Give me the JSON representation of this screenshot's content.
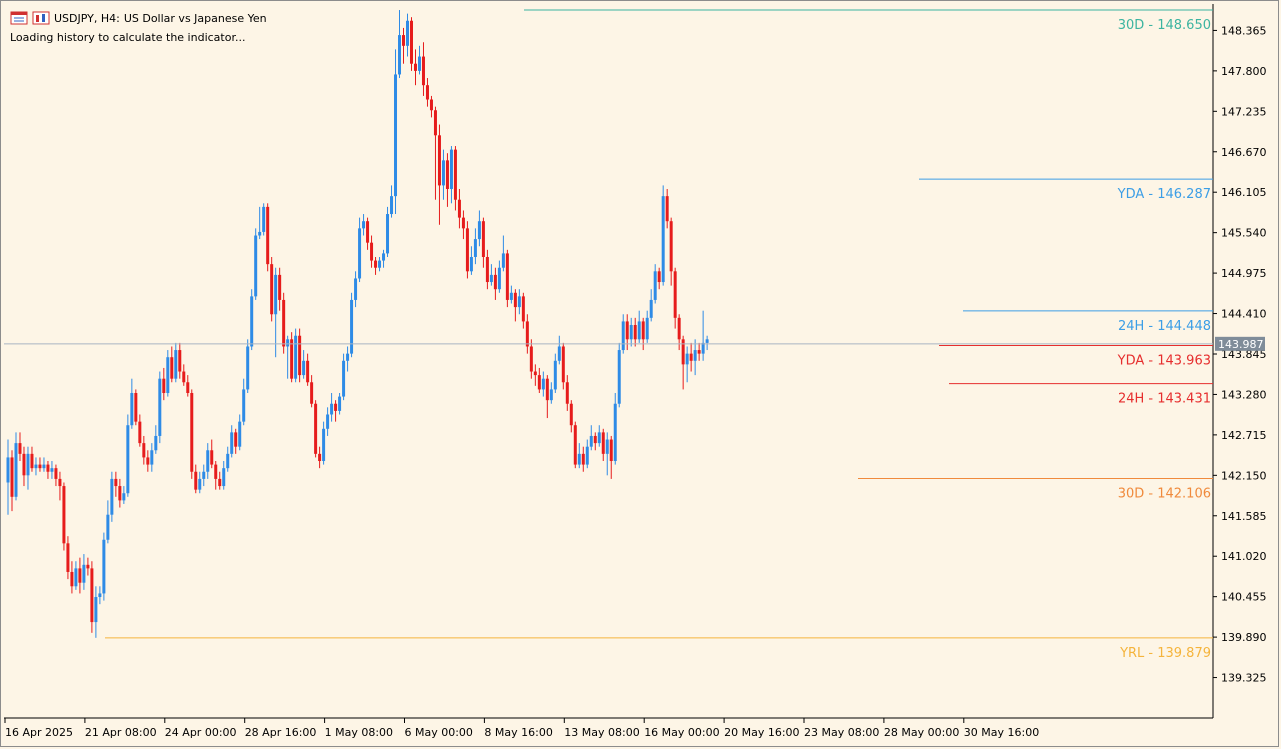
{
  "header": {
    "symbol": "USDJPY, H4:",
    "description": "US Dollar vs Japanese Yen",
    "status": "Loading history to calculate the indicator..."
  },
  "chart_data": {
    "type": "candlestick",
    "symbol": "USDJPY",
    "timeframe": "H4",
    "ylim": [
      138.76,
      148.79
    ],
    "y_ticks": [
      "148.365",
      "147.800",
      "147.235",
      "146.670",
      "146.105",
      "145.540",
      "144.975",
      "144.410",
      "143.845",
      "143.280",
      "142.715",
      "142.150",
      "141.585",
      "141.020",
      "140.455",
      "139.890",
      "139.325"
    ],
    "x_ticks": [
      "16 Apr 2025",
      "21 Apr 08:00",
      "24 Apr 00:00",
      "28 Apr 16:00",
      "1 May 08:00",
      "6 May 00:00",
      "8 May 16:00",
      "13 May 08:00",
      "16 May 00:00",
      "20 May 16:00",
      "23 May 08:00",
      "28 May 00:00",
      "30 May 16:00"
    ],
    "current_price": {
      "value": 143.987,
      "label": "143.987",
      "color": "#7f8c99"
    },
    "levels": [
      {
        "label": "30D - 148.650",
        "value": 148.65,
        "color": "#3cb4a0",
        "x_start": 524
      },
      {
        "label": "YDA - 146.287",
        "value": 146.287,
        "color": "#3c9ee6",
        "x_start": 919
      },
      {
        "label": "24H - 144.448",
        "value": 144.448,
        "color": "#3c9ee6",
        "x_start": 963
      },
      {
        "label": "YDA - 143.963",
        "value": 143.963,
        "color": "#e62e2e",
        "x_start": 939
      },
      {
        "label": "24H - 143.431",
        "value": 143.431,
        "color": "#e62e2e",
        "x_start": 949
      },
      {
        "label": "30D - 142.106",
        "value": 142.106,
        "color": "#f08a3c",
        "x_start": 858
      },
      {
        "label": "YRL - 139.879",
        "value": 139.879,
        "color": "#f5b43c",
        "x_start": 105
      }
    ],
    "candle_colors": {
      "up": "#2e8be6",
      "down": "#e61c1c"
    },
    "candle_x_start": 8,
    "candle_spacing": 3.995,
    "candles": [
      [
        142.05,
        142.4,
        142.65,
        141.6
      ],
      [
        142.4,
        141.85,
        142.5,
        141.65
      ],
      [
        141.85,
        142.6,
        142.75,
        141.8
      ],
      [
        142.6,
        142.45,
        142.75,
        142.35
      ],
      [
        142.45,
        142.15,
        142.55,
        142.0
      ],
      [
        142.15,
        142.45,
        142.55,
        141.95
      ],
      [
        142.45,
        142.25,
        142.55,
        142.2
      ],
      [
        142.25,
        142.3,
        142.4,
        142.15
      ],
      [
        142.3,
        142.25,
        142.4,
        142.2
      ],
      [
        142.25,
        142.3,
        142.4,
        142.2
      ],
      [
        142.3,
        142.2,
        142.35,
        142.1
      ],
      [
        142.2,
        142.25,
        142.35,
        142.1
      ],
      [
        142.25,
        142.1,
        142.3,
        142.0
      ],
      [
        142.1,
        142.0,
        142.2,
        141.8
      ],
      [
        142.0,
        141.2,
        142.05,
        141.1
      ],
      [
        141.2,
        140.8,
        141.3,
        140.7
      ],
      [
        140.8,
        140.6,
        140.95,
        140.5
      ],
      [
        140.6,
        140.85,
        140.95,
        140.55
      ],
      [
        140.85,
        140.65,
        141.0,
        140.5
      ],
      [
        140.65,
        140.9,
        141.05,
        140.55
      ],
      [
        140.9,
        140.85,
        141.0,
        140.75
      ],
      [
        140.85,
        140.1,
        140.95,
        139.95
      ],
      [
        140.1,
        140.45,
        140.6,
        139.88
      ],
      [
        140.45,
        140.5,
        140.6,
        140.35
      ],
      [
        140.5,
        141.25,
        141.35,
        140.4
      ],
      [
        141.25,
        141.6,
        141.8,
        141.2
      ],
      [
        141.6,
        142.1,
        142.2,
        141.5
      ],
      [
        142.1,
        142.0,
        142.2,
        141.85
      ],
      [
        142.0,
        141.8,
        142.1,
        141.7
      ],
      [
        141.8,
        141.9,
        142.0,
        141.75
      ],
      [
        141.9,
        142.85,
        143.0,
        141.85
      ],
      [
        142.85,
        143.3,
        143.5,
        142.8
      ],
      [
        143.3,
        142.9,
        143.35,
        142.85
      ],
      [
        142.9,
        142.6,
        143.0,
        142.55
      ],
      [
        142.6,
        142.4,
        142.7,
        142.3
      ],
      [
        142.4,
        142.3,
        142.5,
        142.2
      ],
      [
        142.3,
        142.5,
        142.6,
        142.2
      ],
      [
        142.5,
        142.7,
        142.85,
        142.45
      ],
      [
        142.7,
        143.5,
        143.6,
        142.6
      ],
      [
        143.5,
        143.3,
        143.65,
        143.2
      ],
      [
        143.3,
        143.8,
        143.9,
        143.25
      ],
      [
        143.8,
        143.5,
        143.95,
        143.45
      ],
      [
        143.5,
        143.9,
        144.0,
        143.45
      ],
      [
        143.9,
        143.6,
        144.0,
        143.5
      ],
      [
        143.6,
        143.45,
        143.7,
        143.4
      ],
      [
        143.45,
        143.3,
        143.55,
        143.25
      ],
      [
        143.3,
        142.2,
        143.35,
        142.1
      ],
      [
        142.2,
        141.95,
        142.3,
        141.9
      ],
      [
        141.95,
        142.1,
        142.2,
        141.9
      ],
      [
        142.1,
        142.2,
        142.3,
        142.0
      ],
      [
        142.2,
        142.5,
        142.6,
        142.1
      ],
      [
        142.5,
        142.3,
        142.65,
        142.25
      ],
      [
        142.3,
        142.1,
        142.35,
        141.95
      ],
      [
        142.1,
        142.0,
        142.2,
        141.95
      ],
      [
        142.0,
        142.25,
        142.35,
        141.95
      ],
      [
        142.25,
        142.45,
        142.55,
        142.2
      ],
      [
        142.45,
        142.75,
        142.85,
        142.4
      ],
      [
        142.75,
        142.55,
        142.8,
        142.45
      ],
      [
        142.55,
        142.9,
        143.0,
        142.5
      ],
      [
        142.9,
        143.35,
        143.5,
        142.85
      ],
      [
        143.35,
        143.95,
        144.05,
        143.3
      ],
      [
        143.95,
        144.65,
        144.75,
        143.9
      ],
      [
        144.65,
        145.5,
        145.6,
        144.6
      ],
      [
        145.5,
        145.55,
        145.9,
        145.45
      ],
      [
        145.55,
        145.9,
        145.95,
        145.5
      ],
      [
        145.9,
        145.1,
        145.95,
        145.0
      ],
      [
        145.1,
        144.4,
        145.2,
        144.3
      ],
      [
        144.4,
        144.95,
        145.05,
        143.8
      ],
      [
        144.95,
        144.6,
        145.05,
        144.45
      ],
      [
        144.6,
        143.95,
        144.7,
        143.85
      ],
      [
        143.95,
        144.05,
        144.1,
        143.5
      ],
      [
        144.05,
        143.5,
        144.15,
        143.45
      ],
      [
        143.5,
        144.1,
        144.2,
        143.45
      ],
      [
        144.1,
        143.55,
        144.2,
        143.45
      ],
      [
        143.55,
        143.75,
        143.9,
        143.5
      ],
      [
        143.75,
        143.45,
        143.85,
        143.4
      ],
      [
        143.45,
        143.15,
        143.55,
        143.1
      ],
      [
        143.15,
        142.45,
        143.2,
        142.4
      ],
      [
        142.45,
        142.35,
        142.55,
        142.25
      ],
      [
        142.35,
        142.8,
        142.9,
        142.3
      ],
      [
        142.8,
        143.0,
        143.1,
        142.7
      ],
      [
        143.0,
        143.15,
        143.3,
        142.9
      ],
      [
        143.15,
        143.05,
        143.2,
        142.9
      ],
      [
        143.05,
        143.25,
        143.3,
        143.0
      ],
      [
        143.25,
        143.75,
        143.85,
        143.2
      ],
      [
        143.75,
        143.85,
        143.95,
        143.6
      ],
      [
        143.85,
        144.6,
        144.7,
        143.8
      ],
      [
        144.6,
        144.9,
        145.0,
        144.5
      ],
      [
        144.9,
        145.6,
        145.75,
        144.85
      ],
      [
        145.6,
        145.7,
        145.8,
        145.5
      ],
      [
        145.7,
        145.4,
        145.75,
        145.3
      ],
      [
        145.4,
        145.15,
        145.5,
        145.05
      ],
      [
        145.15,
        145.05,
        145.2,
        144.95
      ],
      [
        145.05,
        145.15,
        145.2,
        145.0
      ],
      [
        145.15,
        145.25,
        145.3,
        145.05
      ],
      [
        145.25,
        145.8,
        145.9,
        145.2
      ],
      [
        145.8,
        146.05,
        146.2,
        145.75
      ],
      [
        146.05,
        147.75,
        148.1,
        145.8
      ],
      [
        147.75,
        148.3,
        148.65,
        147.7
      ],
      [
        148.3,
        148.15,
        148.4,
        147.9
      ],
      [
        148.15,
        148.5,
        148.6,
        148.0
      ],
      [
        148.5,
        147.9,
        148.55,
        147.8
      ],
      [
        147.9,
        147.8,
        148.1,
        147.6
      ],
      [
        147.8,
        148.0,
        148.15,
        147.75
      ],
      [
        148.0,
        147.6,
        148.2,
        147.45
      ],
      [
        147.6,
        147.4,
        147.7,
        147.3
      ],
      [
        147.4,
        147.25,
        147.45,
        147.15
      ],
      [
        147.25,
        146.9,
        147.3,
        146.0
      ],
      [
        146.9,
        146.2,
        147.05,
        145.65
      ],
      [
        146.2,
        146.55,
        146.7,
        146.0
      ],
      [
        146.55,
        146.15,
        146.65,
        145.9
      ],
      [
        146.15,
        146.7,
        146.75,
        145.95
      ],
      [
        146.7,
        146.0,
        146.75,
        145.85
      ],
      [
        146.0,
        145.75,
        146.15,
        145.6
      ],
      [
        145.75,
        145.6,
        145.85,
        145.45
      ],
      [
        145.6,
        145.0,
        145.7,
        144.9
      ],
      [
        145.0,
        145.2,
        145.35,
        144.95
      ],
      [
        145.2,
        145.45,
        145.6,
        145.1
      ],
      [
        145.45,
        145.7,
        145.85,
        145.35
      ],
      [
        145.7,
        145.2,
        145.75,
        145.05
      ],
      [
        145.2,
        144.85,
        145.3,
        144.75
      ],
      [
        144.85,
        144.95,
        145.1,
        144.8
      ],
      [
        144.95,
        144.75,
        145.05,
        144.6
      ],
      [
        144.75,
        145.05,
        145.15,
        144.7
      ],
      [
        145.05,
        145.25,
        145.5,
        145.0
      ],
      [
        145.25,
        144.6,
        145.3,
        144.5
      ],
      [
        144.6,
        144.7,
        144.8,
        144.55
      ],
      [
        144.7,
        144.5,
        144.75,
        144.3
      ],
      [
        144.5,
        144.65,
        144.75,
        144.4
      ],
      [
        144.65,
        144.3,
        144.7,
        144.2
      ],
      [
        144.3,
        143.95,
        144.4,
        143.85
      ],
      [
        143.95,
        143.6,
        144.05,
        143.5
      ],
      [
        143.6,
        143.55,
        143.7,
        143.4
      ],
      [
        143.55,
        143.35,
        143.65,
        143.3
      ],
      [
        143.35,
        143.5,
        143.6,
        143.25
      ],
      [
        143.5,
        143.2,
        143.55,
        142.95
      ],
      [
        143.2,
        143.35,
        143.45,
        143.15
      ],
      [
        143.35,
        143.75,
        143.85,
        143.3
      ],
      [
        143.75,
        143.95,
        144.1,
        143.7
      ],
      [
        143.95,
        143.45,
        144.0,
        143.35
      ],
      [
        143.45,
        143.15,
        143.55,
        143.05
      ],
      [
        143.15,
        142.85,
        143.2,
        142.75
      ],
      [
        142.85,
        142.3,
        142.9,
        142.25
      ],
      [
        142.3,
        142.45,
        142.6,
        142.25
      ],
      [
        142.45,
        142.3,
        142.55,
        142.2
      ],
      [
        142.3,
        142.55,
        142.65,
        142.25
      ],
      [
        142.55,
        142.7,
        142.85,
        142.5
      ],
      [
        142.7,
        142.6,
        142.75,
        142.5
      ],
      [
        142.6,
        142.75,
        142.85,
        142.55
      ],
      [
        142.75,
        142.45,
        142.8,
        142.35
      ],
      [
        142.45,
        142.65,
        142.75,
        142.15
      ],
      [
        142.65,
        142.35,
        142.7,
        142.1
      ],
      [
        142.35,
        143.15,
        143.3,
        142.3
      ],
      [
        143.15,
        143.9,
        144.0,
        143.1
      ],
      [
        143.9,
        144.3,
        144.4,
        143.85
      ],
      [
        144.3,
        144.05,
        144.4,
        143.9
      ],
      [
        144.05,
        144.25,
        144.35,
        143.95
      ],
      [
        144.25,
        144.05,
        144.35,
        143.95
      ],
      [
        144.05,
        144.3,
        144.45,
        144.0
      ],
      [
        144.3,
        144.05,
        144.35,
        143.9
      ],
      [
        144.05,
        144.35,
        144.45,
        144.0
      ],
      [
        144.35,
        144.6,
        144.75,
        144.3
      ],
      [
        144.6,
        145.0,
        145.1,
        144.55
      ],
      [
        145.0,
        144.85,
        145.05,
        144.75
      ],
      [
        144.85,
        146.05,
        146.2,
        144.8
      ],
      [
        146.05,
        145.7,
        146.15,
        145.6
      ],
      [
        145.7,
        145.0,
        145.75,
        144.8
      ],
      [
        145.0,
        144.35,
        145.05,
        144.2
      ],
      [
        144.35,
        144.05,
        144.4,
        143.9
      ],
      [
        144.05,
        143.7,
        144.1,
        143.35
      ],
      [
        143.7,
        143.85,
        143.95,
        143.45
      ],
      [
        143.85,
        143.75,
        144.0,
        143.6
      ],
      [
        143.75,
        143.9,
        144.05,
        143.55
      ],
      [
        143.9,
        143.85,
        144.0,
        143.75
      ],
      [
        143.85,
        144.0,
        144.45,
        143.75
      ],
      [
        144.0,
        144.05,
        144.1,
        143.9
      ]
    ]
  }
}
